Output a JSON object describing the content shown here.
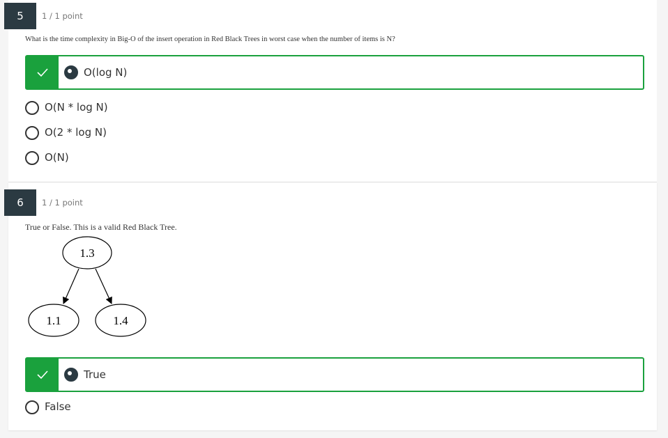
{
  "questions": [
    {
      "number": "5",
      "points": "1 / 1 point",
      "prompt": "What is the time complexity in Big-O of the insert operation in Red Black Trees in worst case when the number of items is N?",
      "selected_option": "O(log N)",
      "options": [
        "O(N * log N)",
        "O(2 * log N)",
        "O(N)"
      ]
    },
    {
      "number": "6",
      "points": "1 / 1 point",
      "prompt": "True or False. This is a valid Red Black Tree.",
      "tree": {
        "root": "1.3",
        "left": "1.1",
        "right": "1.4"
      },
      "selected_option": "True",
      "options": [
        "False"
      ]
    }
  ],
  "colors": {
    "correct_green": "#1aa13d",
    "number_badge": "#2b3a42"
  },
  "icons": {
    "correct": "check-icon"
  }
}
